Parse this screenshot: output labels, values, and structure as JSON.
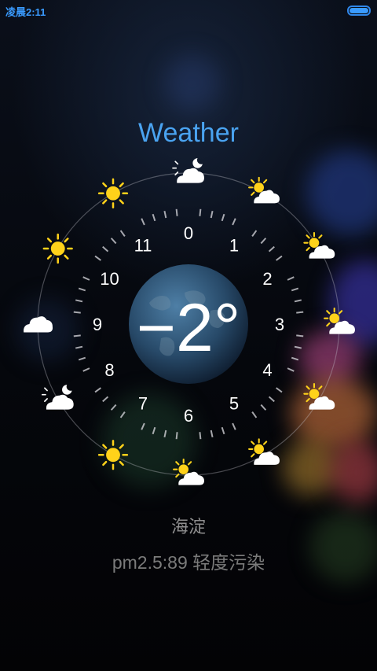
{
  "status_bar": {
    "time": "凌晨2:11",
    "battery": "full"
  },
  "title": "Weather",
  "temperature": "−2°",
  "city": "海淀",
  "air_quality": "pm2.5:89 轻度污染",
  "hours": [
    "0",
    "1",
    "2",
    "3",
    "4",
    "5",
    "6",
    "7",
    "8",
    "9",
    "10",
    "11"
  ],
  "forecast": [
    {
      "hour": "0",
      "icon": "cloudy-night-icon"
    },
    {
      "hour": "1",
      "icon": "partly-cloudy-icon"
    },
    {
      "hour": "2",
      "icon": "partly-cloudy-icon"
    },
    {
      "hour": "3",
      "icon": "partly-cloudy-icon"
    },
    {
      "hour": "4",
      "icon": "partly-cloudy-icon"
    },
    {
      "hour": "5",
      "icon": "partly-cloudy-icon"
    },
    {
      "hour": "6",
      "icon": "partly-cloudy-icon"
    },
    {
      "hour": "7",
      "icon": "sun-icon"
    },
    {
      "hour": "8",
      "icon": "cloudy-night-icon"
    },
    {
      "hour": "9",
      "icon": "cloud-icon"
    },
    {
      "hour": "10",
      "icon": "sun-icon"
    },
    {
      "hour": "11",
      "icon": "sun-icon"
    }
  ],
  "colors": {
    "accent": "#4aa3f0",
    "sun": "#ffd21a",
    "cloud": "#ffffff"
  }
}
